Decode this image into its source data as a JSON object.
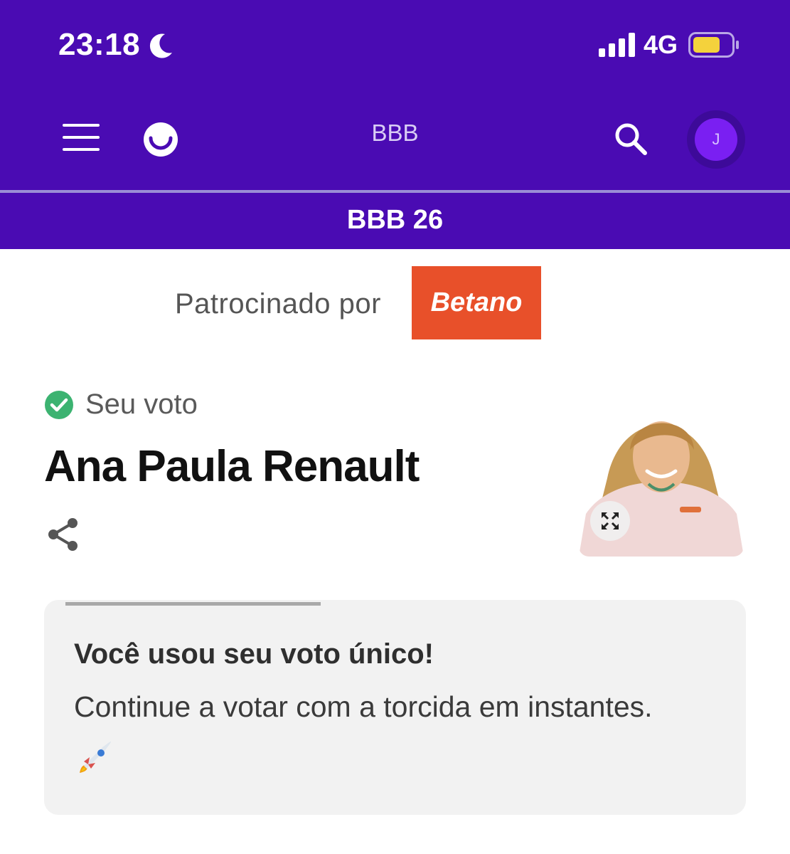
{
  "status_bar": {
    "time": "23:18",
    "network": "4G"
  },
  "header": {
    "title": "BBB",
    "avatar_initial": "J"
  },
  "subheader": {
    "title": "BBB 26"
  },
  "sponsor": {
    "label": "Patrocinado por",
    "brand": "Betano"
  },
  "vote": {
    "label": "Seu voto",
    "candidate_name": "Ana Paula Renault"
  },
  "card": {
    "title": "Você usou seu voto único!",
    "message": "Continue a votar com a torcida em instantes."
  },
  "colors": {
    "header_bg": "#4a0bb3",
    "avatar": "#7a1ff2",
    "sponsor_bg": "#e8502a",
    "check": "#3cb371",
    "battery": "#f4d23c"
  },
  "icons": [
    "moon-icon",
    "signal-icon",
    "battery-icon",
    "menu-icon",
    "logo-icon",
    "search-icon",
    "check-icon",
    "share-icon",
    "expand-icon",
    "rocket-icon"
  ]
}
